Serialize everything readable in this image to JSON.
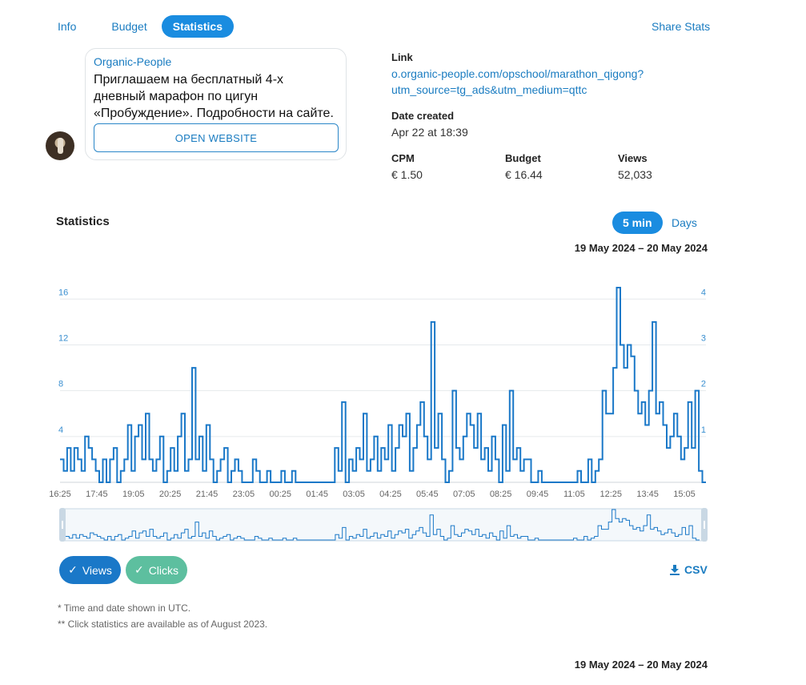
{
  "tabs": [
    {
      "label": "Info",
      "active": false
    },
    {
      "label": "Budget",
      "active": false
    },
    {
      "label": "Statistics",
      "active": true
    }
  ],
  "share_label": "Share Stats",
  "ad": {
    "sender": "Organic-People",
    "message": "Приглашаем на бесплатный 4-х дневный марафон по цигун «Пробуждение». Подробности на сайте.",
    "button": "OPEN WEBSITE"
  },
  "details": {
    "link_label": "Link",
    "link_line1": "o.organic-people.com/opschool/marathon_qigong?",
    "link_line2": "utm_source=tg_ads&utm_medium=qttc",
    "date_label": "Date created",
    "date_value": "Apr 22 at 18:39",
    "cpm_label": "CPM",
    "cpm_value": "€ 1.50",
    "budget_label": "Budget",
    "budget_value": "€ 16.44",
    "views_label": "Views",
    "views_value": "52,033"
  },
  "stats": {
    "title": "Statistics",
    "toggle_5min": "5 min",
    "toggle_days": "Days",
    "date_range": "19 May 2024 – 20 May 2024",
    "date_range_bottom": "19 May 2024 – 20 May 2024"
  },
  "legend": {
    "views": "Views",
    "clicks": "Clicks",
    "csv": "CSV"
  },
  "notes": {
    "note1": "* Time and date shown in UTC.",
    "note2": "** Click statistics are available as of August 2023."
  },
  "colors": {
    "accent": "#1a8ce0",
    "views": "#1a78c8",
    "clicks": "#5dbf9f",
    "grid": "#e6e9ec"
  },
  "chart_data": {
    "type": "line",
    "x_labels": [
      "16:25",
      "17:45",
      "19:05",
      "20:25",
      "21:45",
      "23:05",
      "00:25",
      "01:45",
      "03:05",
      "04:25",
      "05:45",
      "07:05",
      "08:25",
      "09:45",
      "11:05",
      "12:25",
      "13:45",
      "15:05"
    ],
    "y_left_ticks": [
      "4",
      "8",
      "12",
      "16"
    ],
    "y_right_ticks": [
      "1",
      "2",
      "3",
      "4"
    ],
    "ylim_left": [
      0,
      17
    ],
    "ylim_right": [
      0,
      4.25
    ],
    "step": true,
    "series": [
      {
        "name": "Views",
        "values": [
          2,
          1,
          3,
          1,
          3,
          2,
          1,
          4,
          3,
          2,
          1,
          0,
          2,
          0,
          2,
          3,
          0,
          1,
          2,
          5,
          1,
          4,
          5,
          2,
          6,
          2,
          1,
          2,
          4,
          0,
          1,
          3,
          1,
          4,
          6,
          1,
          2,
          10,
          2,
          4,
          1,
          5,
          2,
          0,
          1,
          2,
          3,
          0,
          1,
          2,
          1,
          0,
          0,
          0,
          2,
          1,
          0,
          0,
          1,
          0,
          0,
          0,
          1,
          0,
          0,
          1,
          0,
          0,
          0,
          0,
          0,
          0,
          0,
          0,
          0,
          0,
          0,
          3,
          1,
          7,
          0,
          2,
          1,
          3,
          2,
          6,
          1,
          2,
          4,
          1,
          3,
          2,
          5,
          1,
          3,
          5,
          4,
          6,
          1,
          3,
          5,
          7,
          4,
          2,
          14,
          3,
          6,
          2,
          0,
          1,
          8,
          3,
          2,
          4,
          6,
          5,
          3,
          6,
          2,
          3,
          1,
          4,
          2,
          0,
          5,
          1,
          8,
          2,
          3,
          1,
          2,
          2,
          0,
          0,
          1,
          0,
          0,
          0,
          0,
          0,
          0,
          0,
          0,
          0,
          0,
          1,
          0,
          0,
          2,
          0,
          1,
          2,
          8,
          6,
          6,
          10,
          17,
          12,
          10,
          12,
          11,
          8,
          6,
          7,
          5,
          8,
          14,
          6,
          7,
          5,
          3,
          4,
          6,
          4,
          2,
          3,
          7,
          3,
          8,
          1,
          0
        ]
      }
    ]
  }
}
